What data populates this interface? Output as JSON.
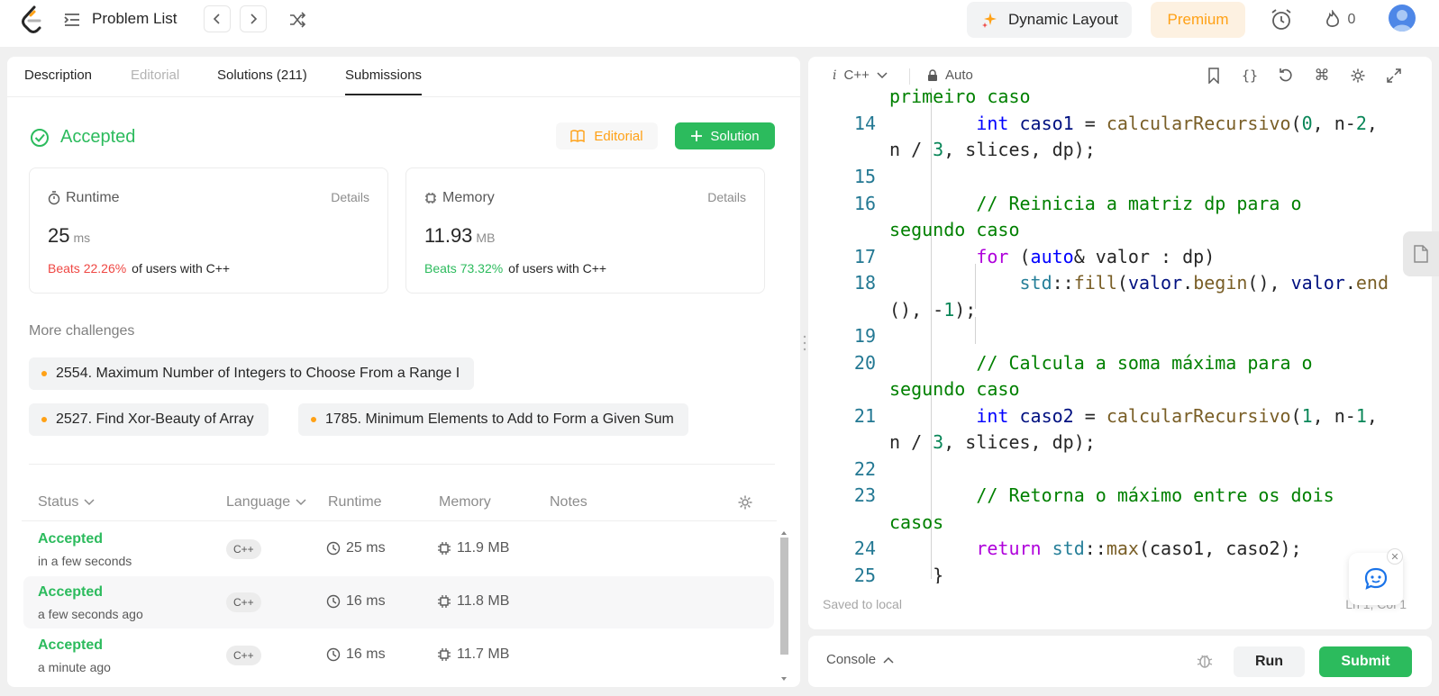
{
  "header": {
    "problem_list": "Problem List",
    "dynamic_layout": "Dynamic Layout",
    "premium": "Premium",
    "streak_count": "0"
  },
  "tabs": [
    {
      "label": "Description"
    },
    {
      "label": "Editorial"
    },
    {
      "label": "Solutions (211)"
    },
    {
      "label": "Submissions"
    }
  ],
  "result": {
    "status": "Accepted",
    "editorial_btn": "Editorial",
    "solution_btn": "Solution"
  },
  "runtime": {
    "title": "Runtime",
    "details": "Details",
    "value": "25",
    "unit": "ms",
    "beats": "Beats 22.26%",
    "rest": "of users with C++"
  },
  "memory": {
    "title": "Memory",
    "details": "Details",
    "value": "11.93",
    "unit": "MB",
    "beats": "Beats 73.32%",
    "rest": "of users with C++"
  },
  "more_challenges": {
    "title": "More challenges",
    "items": [
      "2554. Maximum Number of Integers to Choose From a Range I",
      "2527. Find Xor-Beauty of Array",
      "1785. Minimum Elements to Add to Form a Given Sum"
    ]
  },
  "table": {
    "headers": [
      "Status",
      "Language",
      "Runtime",
      "Memory",
      "Notes"
    ],
    "rows": [
      {
        "status": "Accepted",
        "time": "in a few seconds",
        "lang": "C++",
        "runtime": "25 ms",
        "memory": "11.9 MB"
      },
      {
        "status": "Accepted",
        "time": "a few seconds ago",
        "lang": "C++",
        "runtime": "16 ms",
        "memory": "11.8 MB"
      },
      {
        "status": "Accepted",
        "time": "a minute ago",
        "lang": "C++",
        "runtime": "16 ms",
        "memory": "11.7 MB"
      }
    ]
  },
  "editor": {
    "language": "C++",
    "mode": "Auto",
    "saved": "Saved to local",
    "cursor": "Ln 1, Col 1",
    "line_numbers": [
      "14",
      "15",
      "16",
      "17",
      "18",
      "19",
      "20",
      "21",
      "22",
      "23",
      "24",
      "25"
    ]
  },
  "console": {
    "label": "Console",
    "run": "Run",
    "submit": "Submit"
  },
  "colors": {
    "accent_green": "#2cbb5d",
    "accent_orange": "#ffa116",
    "beats_red": "#ef4743"
  }
}
